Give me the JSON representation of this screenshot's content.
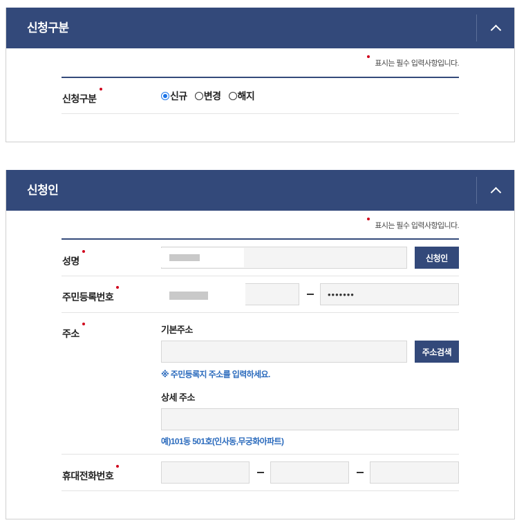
{
  "section1": {
    "title": "신청구분",
    "required_note": "표시는 필수 입력사항입니다.",
    "field_label": "신청구분",
    "options": [
      {
        "label": "신규",
        "selected": true
      },
      {
        "label": "변경",
        "selected": false
      },
      {
        "label": "해지",
        "selected": false
      }
    ]
  },
  "section2": {
    "title": "신청인",
    "required_note": "표시는 필수 입력사항입니다.",
    "name": {
      "label": "성명",
      "button": "신청인"
    },
    "rrn": {
      "label": "주민등록번호",
      "masked_value": "•••••••"
    },
    "address": {
      "label": "주소",
      "basic_label": "기본주소",
      "search_button": "주소검색",
      "basic_hint": "※ 주민등록지 주소를 입력하세요.",
      "detail_label": "상세 주소",
      "detail_hint": "예)101동 501호(인사동,무궁화아파트)"
    },
    "phone": {
      "label": "휴대전화번호"
    }
  },
  "colors": {
    "header": "#33497a",
    "required_dot": "#d0021b",
    "hint": "#2b6bbd"
  },
  "icons": {
    "collapse": "chevron-up-icon"
  }
}
